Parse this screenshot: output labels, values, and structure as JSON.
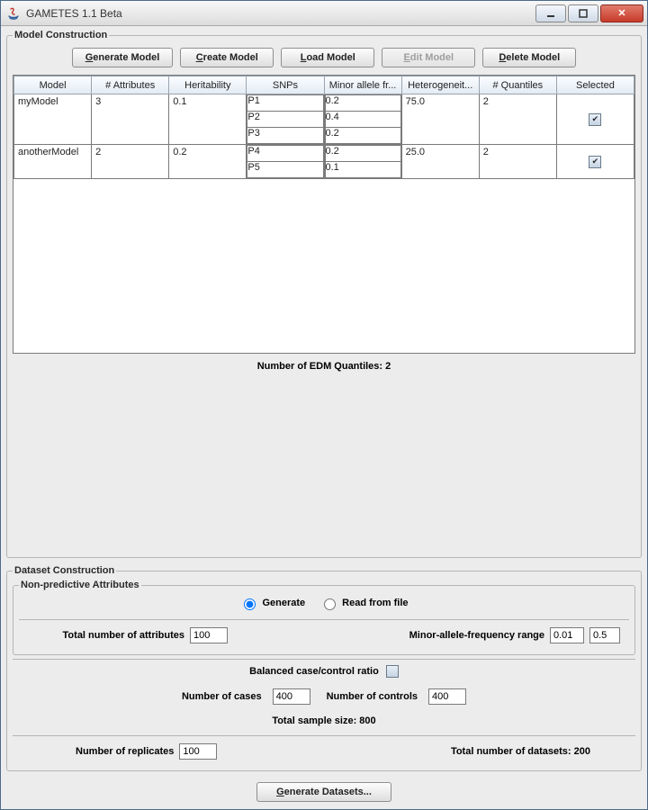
{
  "window": {
    "title": "GAMETES 1.1 Beta"
  },
  "model_construction": {
    "title": "Model Construction",
    "buttons": {
      "generate": "Generate Model",
      "create": "Create Model",
      "load": "Load Model",
      "edit": "Edit Model",
      "delete": "Delete Model"
    },
    "columns": [
      "Model",
      "# Attributes",
      "Heritability",
      "SNPs",
      "Minor allele fr...",
      "Heterogeneit...",
      "# Quantiles",
      "Selected"
    ],
    "rows": [
      {
        "model": "myModel",
        "attributes": "3",
        "heritability": "0.1",
        "snps": [
          "P1",
          "P2",
          "P3"
        ],
        "mafs": [
          "0.2",
          "0.4",
          "0.2"
        ],
        "heterogeneity": "75.0",
        "quantiles": "2",
        "selected": true
      },
      {
        "model": "anotherModel",
        "attributes": "2",
        "heritability": "0.2",
        "snps": [
          "P4",
          "P5"
        ],
        "mafs": [
          "0.2",
          "0.1"
        ],
        "heterogeneity": "25.0",
        "quantiles": "2",
        "selected": true
      }
    ],
    "edm_label": "Number of EDM Quantiles:  2"
  },
  "dataset_construction": {
    "title": "Dataset Construction",
    "non_predictive": {
      "title": "Non-predictive Attributes",
      "mode_generate": "Generate",
      "mode_readfile": "Read from file",
      "mode_selected": "generate",
      "total_attr_label": "Total number of attributes",
      "total_attr_value": "100",
      "maf_range_label": "Minor-allele-frequency range",
      "maf_low": "0.01",
      "maf_high": "0.5"
    },
    "balanced_label": "Balanced case/control ratio",
    "balanced_checked": false,
    "cases_label": "Number of cases",
    "cases_value": "400",
    "controls_label": "Number of controls",
    "controls_value": "400",
    "total_sample_label": "Total sample size:  800",
    "replicates_label": "Number of replicates",
    "replicates_value": "100",
    "total_datasets_label": "Total number of datasets:  200",
    "generate_button": "Generate Datasets..."
  }
}
